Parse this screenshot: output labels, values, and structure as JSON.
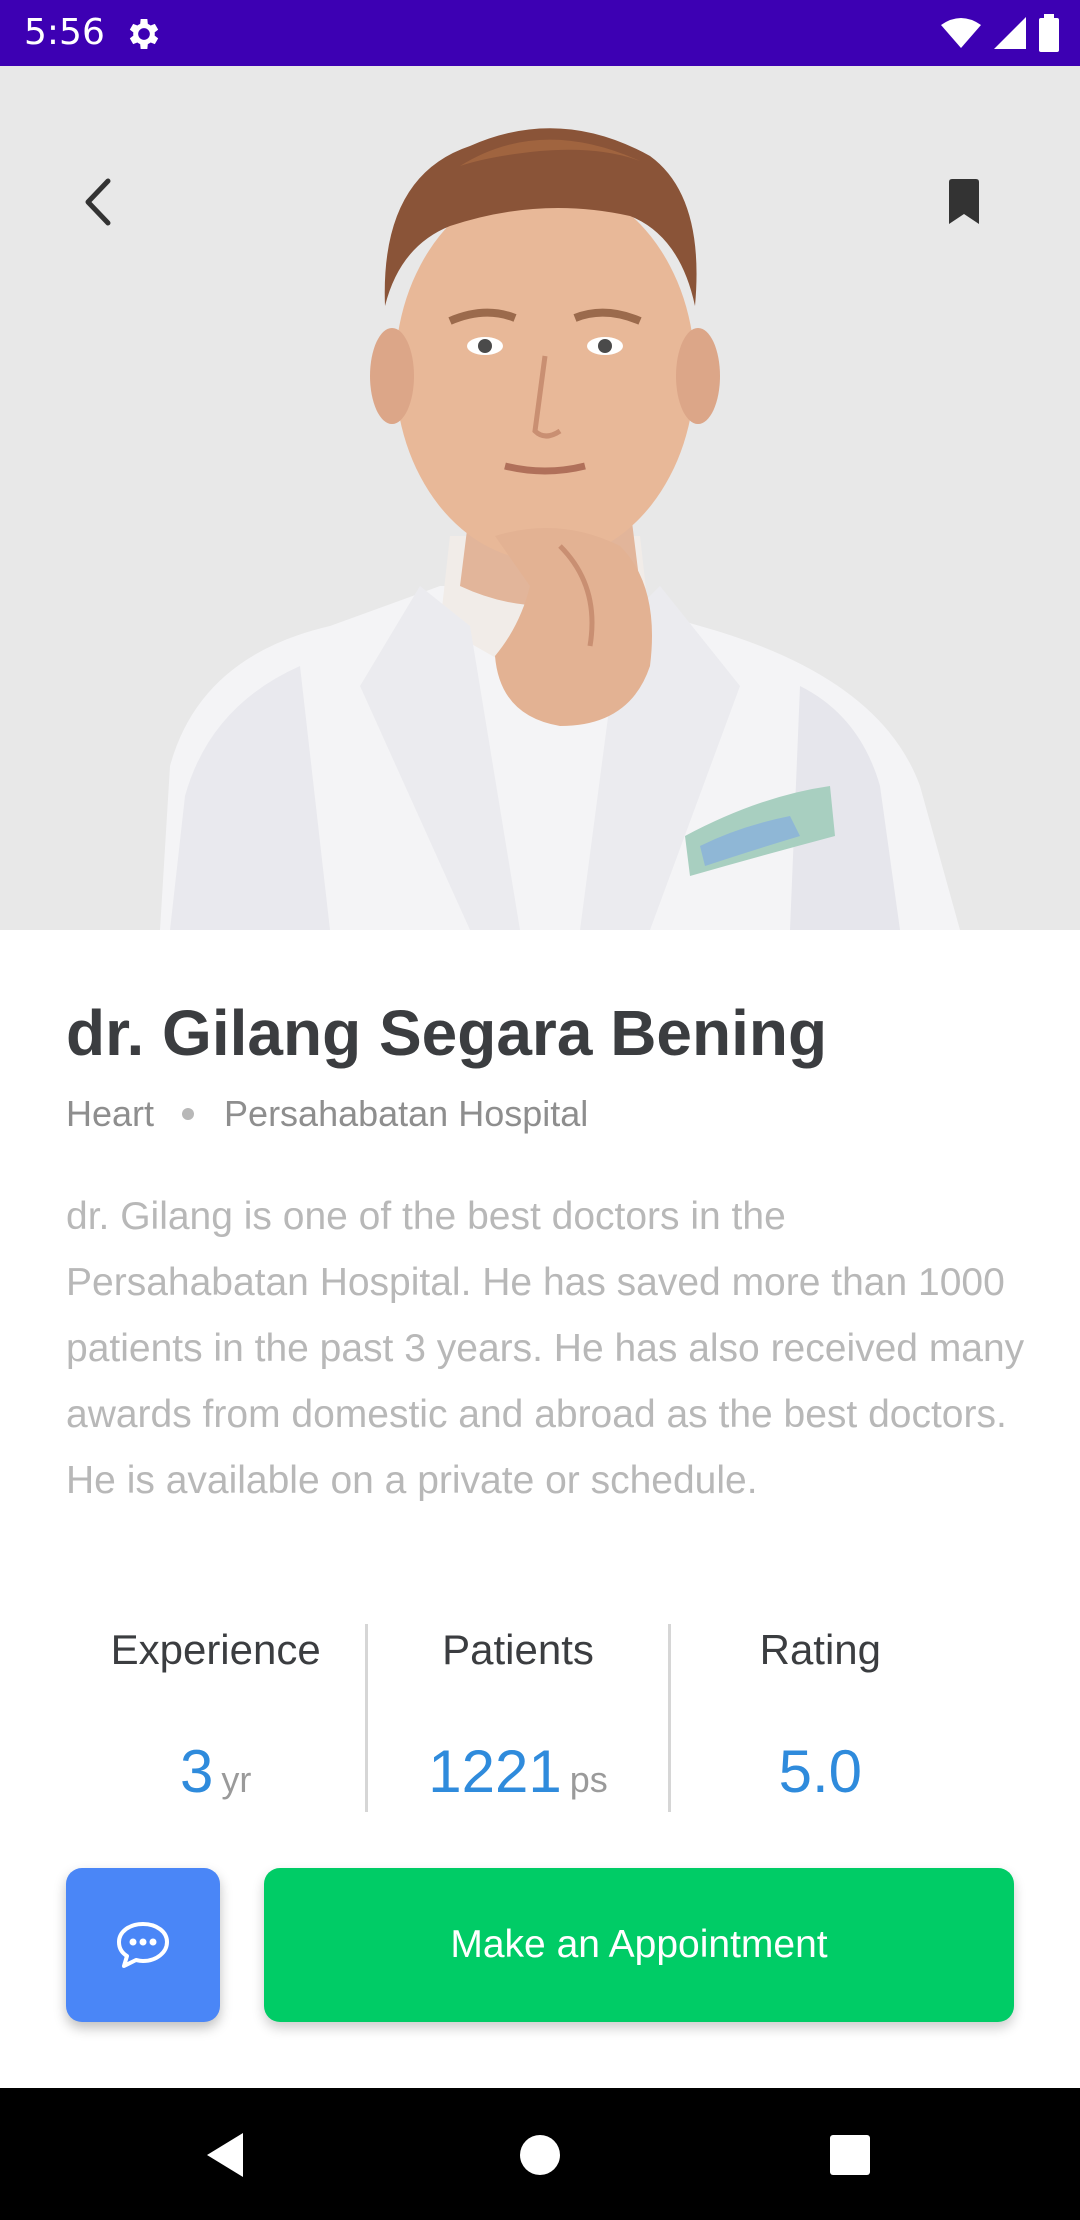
{
  "status_bar": {
    "time": "5:56",
    "icons": [
      "settings-gear-icon",
      "wifi-icon",
      "signal-icon",
      "battery-icon"
    ],
    "background": "#3d00b3"
  },
  "header": {
    "back_icon": "chevron-left-icon",
    "bookmark_icon": "bookmark-icon"
  },
  "doctor": {
    "name": "dr. Gilang Segara Bening",
    "specialty": "Heart",
    "hospital": "Persahabatan Hospital",
    "bio": "dr. Gilang is one of the best doctors in the Persahabatan Hospital. He has saved more than 1000 patients in the past 3 years. He has also received many awards from domestic and abroad as the best doctors. He is available on a private or schedule."
  },
  "stats": [
    {
      "label": "Experience",
      "value": "3",
      "unit": "yr"
    },
    {
      "label": "Patients",
      "value": "1221",
      "unit": "ps"
    },
    {
      "label": "Rating",
      "value": "5.0",
      "unit": ""
    }
  ],
  "actions": {
    "chat_icon": "chat-bubble-icon",
    "appointment_label": "Make an Appointment"
  },
  "colors": {
    "accent_blue": "#2f8bdc",
    "chat_button": "#4a86f7",
    "appointment_button": "#00cc66"
  },
  "nav_bar": {
    "buttons": [
      "back-triangle-icon",
      "home-circle-icon",
      "recents-square-icon"
    ]
  }
}
